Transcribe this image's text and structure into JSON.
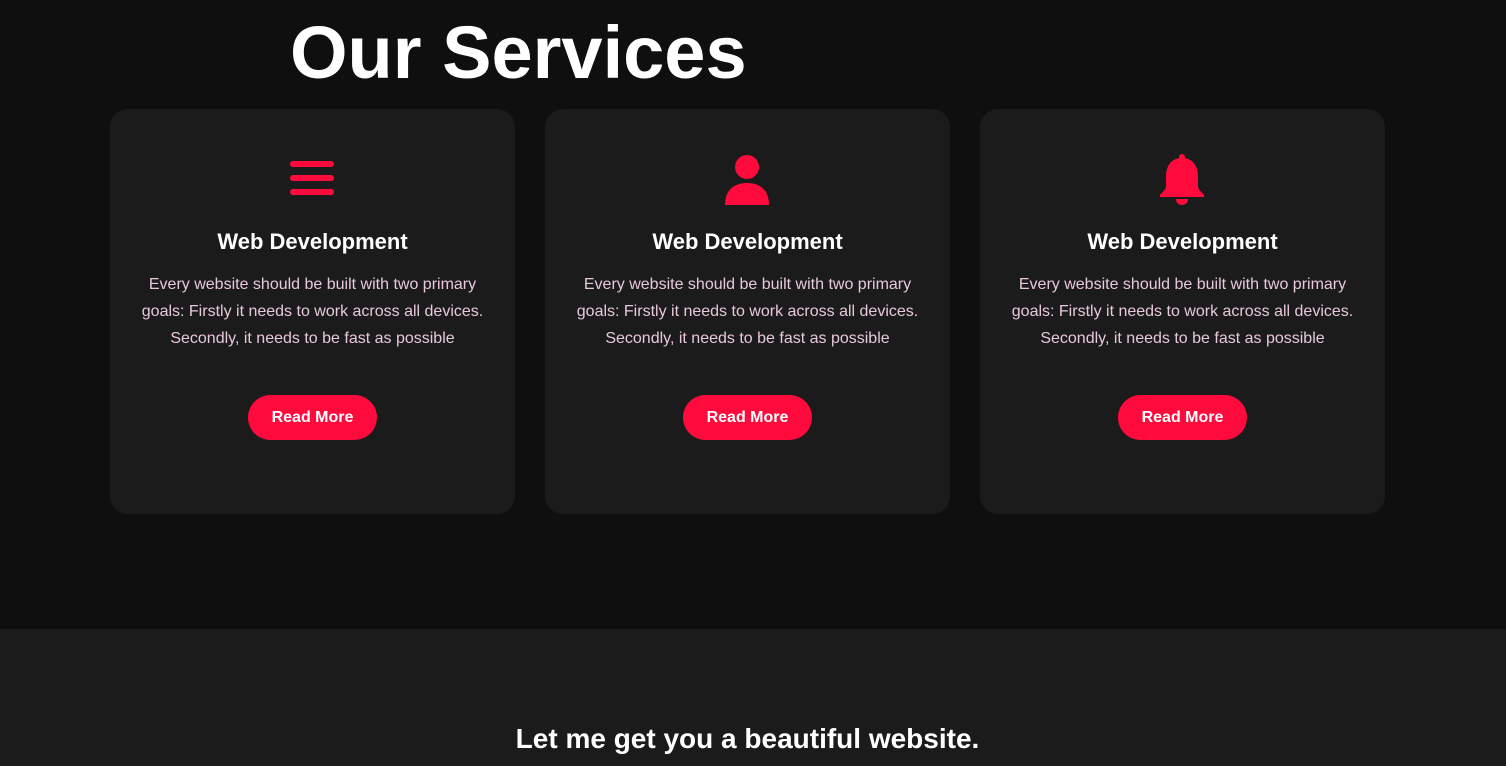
{
  "services": {
    "title": "Our Services",
    "accent_color": "#ff0a3c",
    "cards": [
      {
        "icon": "menu-bars-icon",
        "title": "Web Development",
        "text": "Every website should be built with two primary goals: Firstly it needs to work across all devices. Secondly, it needs to be fast as possible",
        "button_label": "Read More"
      },
      {
        "icon": "user-icon",
        "title": "Web Development",
        "text": "Every website should be built with two primary goals: Firstly it needs to work across all devices. Secondly, it needs to be fast as possible",
        "button_label": "Read More"
      },
      {
        "icon": "bell-icon",
        "title": "Web Development",
        "text": "Every website should be built with two primary goals: Firstly it needs to work across all devices. Secondly, it needs to be fast as possible",
        "button_label": "Read More"
      }
    ]
  },
  "cta": {
    "heading": "Let me get you a beautiful website."
  }
}
